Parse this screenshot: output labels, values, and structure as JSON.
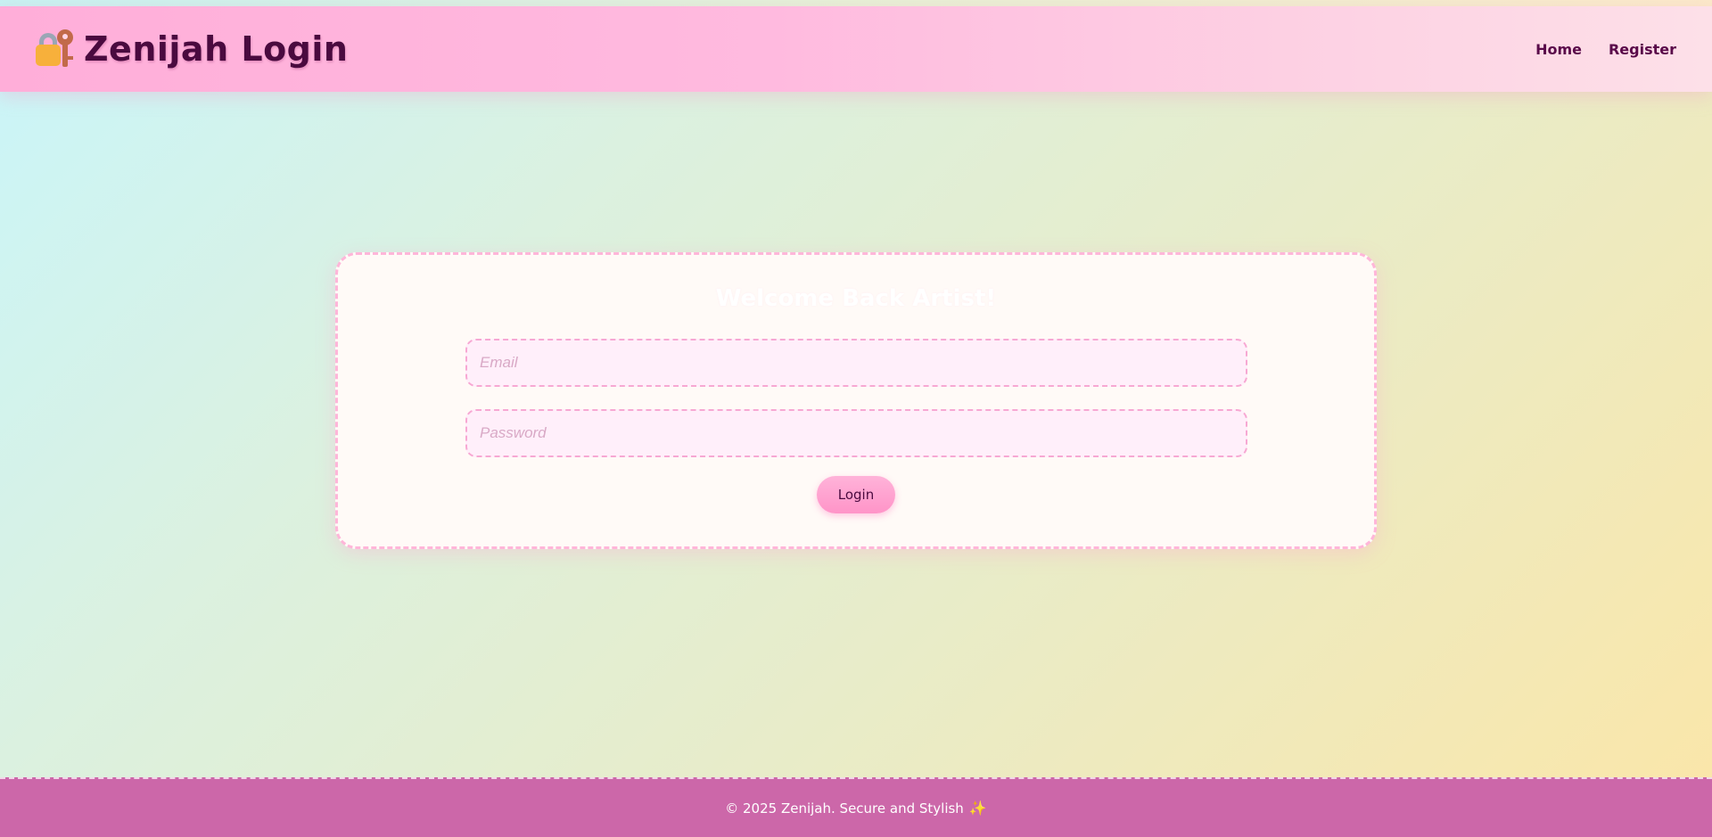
{
  "header": {
    "brand_title": "Zenijah Login",
    "brand_icon": "lock-with-key-icon",
    "nav": {
      "home_label": "Home",
      "register_label": "Register"
    }
  },
  "login_card": {
    "title": "Welcome Back Artist!",
    "email": {
      "placeholder": "Email",
      "value": ""
    },
    "password": {
      "placeholder": "Password",
      "value": ""
    },
    "login_label": "Login"
  },
  "footer": {
    "text": "© 2025 Zenijah. Secure and Stylish",
    "icon": "sparkles-icon",
    "icon_glyph": "✨"
  },
  "colors": {
    "header_pink": "#ffaed9",
    "brand_dark": "#4a0a3f",
    "footer_magenta": "#cc67a9",
    "field_bg": "#ffeffa",
    "field_border": "#f7a8d3",
    "button_pink": "#ff94c8"
  }
}
